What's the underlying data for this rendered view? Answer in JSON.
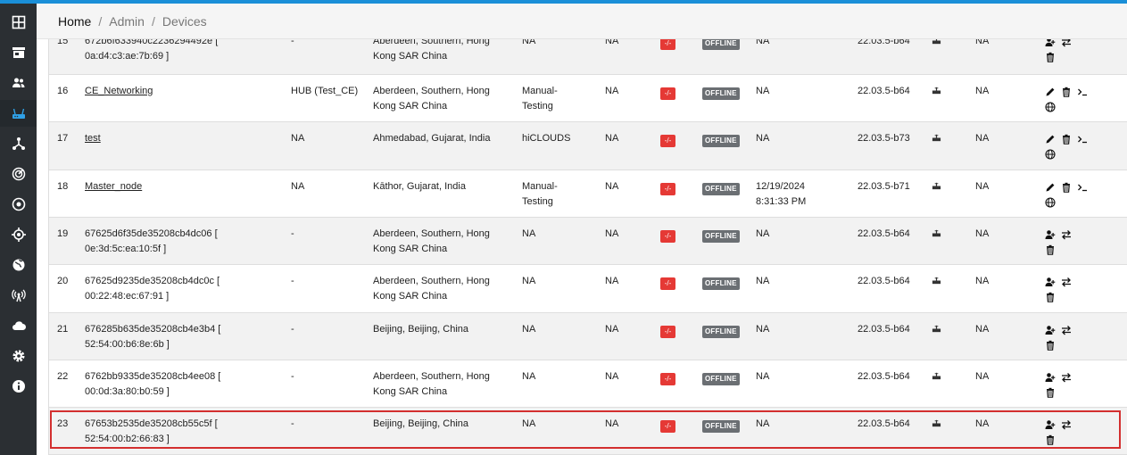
{
  "breadcrumb": {
    "home": "Home",
    "sep1": "/",
    "admin": "Admin",
    "sep2": "/",
    "devices": "Devices"
  },
  "sidebar": {
    "items": [
      {
        "icon": "dashboard-icon"
      },
      {
        "icon": "store-icon"
      },
      {
        "icon": "users-icon"
      },
      {
        "icon": "router-icon",
        "active": true
      },
      {
        "icon": "network-icon"
      },
      {
        "icon": "radar-icon"
      },
      {
        "icon": "target-icon"
      },
      {
        "icon": "crosshair-icon"
      },
      {
        "icon": "globe-icon"
      },
      {
        "icon": "antenna-icon"
      },
      {
        "icon": "cloud-icon"
      },
      {
        "icon": "settings-icon"
      },
      {
        "icon": "info-icon"
      }
    ]
  },
  "colors": {
    "accent": "#1a8fd8",
    "sidebar": "#2b2f33",
    "badge_red": "#e53935",
    "badge_offline": "#6b6f73",
    "highlight": "#d32f2f"
  },
  "rows": [
    {
      "num": "15",
      "name1": "672b6f633940c2236294492e [",
      "name2": "0a:d4:c3:ae:7b:69 ]",
      "link": false,
      "type": "-",
      "loc1": "Aberdeen, Southern, Hong",
      "loc2": "Kong SAR China",
      "org1": "NA",
      "org2": "",
      "na1": "NA",
      "badge": "-/-",
      "status": "OFFLINE",
      "time1": "NA",
      "time2": "",
      "fw": "22.03.5-b64",
      "na2": "NA",
      "actions": "A"
    },
    {
      "num": "16",
      "name1": "CE_Networking",
      "name2": "",
      "link": true,
      "type": "HUB (Test_CE)",
      "loc1": "Aberdeen, Southern, Hong",
      "loc2": "Kong SAR China",
      "org1": "Manual-",
      "org2": "Testing",
      "na1": "NA",
      "badge": "-/-",
      "status": "OFFLINE",
      "time1": "NA",
      "time2": "",
      "fw": "22.03.5-b64",
      "na2": "NA",
      "actions": "B"
    },
    {
      "num": "17",
      "name1": "test",
      "name2": "",
      "link": true,
      "type": "NA",
      "loc1": "Ahmedabad, Gujarat, India",
      "loc2": "",
      "org1": "hiCLOUDS",
      "org2": "",
      "na1": "NA",
      "badge": "-/-",
      "status": "OFFLINE",
      "time1": "NA",
      "time2": "",
      "fw": "22.03.5-b73",
      "na2": "NA",
      "actions": "B"
    },
    {
      "num": "18",
      "name1": "Master_node",
      "name2": "",
      "link": true,
      "type": "NA",
      "loc1": "Kāthor, Gujarat, India",
      "loc2": "",
      "org1": "Manual-",
      "org2": "Testing",
      "na1": "NA",
      "badge": "-/-",
      "status": "OFFLINE",
      "time1": "12/19/2024",
      "time2": "8:31:33 PM",
      "fw": "22.03.5-b71",
      "na2": "NA",
      "actions": "B"
    },
    {
      "num": "19",
      "name1": "67625d6f35de35208cb4dc06 [",
      "name2": "0e:3d:5c:ea:10:5f ]",
      "link": false,
      "type": "-",
      "loc1": "Aberdeen, Southern, Hong",
      "loc2": "Kong SAR China",
      "org1": "NA",
      "org2": "",
      "na1": "NA",
      "badge": "-/-",
      "status": "OFFLINE",
      "time1": "NA",
      "time2": "",
      "fw": "22.03.5-b64",
      "na2": "NA",
      "actions": "A"
    },
    {
      "num": "20",
      "name1": "67625d9235de35208cb4dc0c [",
      "name2": "00:22:48:ec:67:91 ]",
      "link": false,
      "type": "-",
      "loc1": "Aberdeen, Southern, Hong",
      "loc2": "Kong SAR China",
      "org1": "NA",
      "org2": "",
      "na1": "NA",
      "badge": "-/-",
      "status": "OFFLINE",
      "time1": "NA",
      "time2": "",
      "fw": "22.03.5-b64",
      "na2": "NA",
      "actions": "A"
    },
    {
      "num": "21",
      "name1": "676285b635de35208cb4e3b4 [",
      "name2": "52:54:00:b6:8e:6b ]",
      "link": false,
      "type": "-",
      "loc1": "Beijing, Beijing, China",
      "loc2": "",
      "org1": "NA",
      "org2": "",
      "na1": "NA",
      "badge": "-/-",
      "status": "OFFLINE",
      "time1": "NA",
      "time2": "",
      "fw": "22.03.5-b64",
      "na2": "NA",
      "actions": "A"
    },
    {
      "num": "22",
      "name1": "6762bb9335de35208cb4ee08 [",
      "name2": "00:0d:3a:80:b0:59 ]",
      "link": false,
      "type": "-",
      "loc1": "Aberdeen, Southern, Hong",
      "loc2": "Kong SAR China",
      "org1": "NA",
      "org2": "",
      "na1": "NA",
      "badge": "-/-",
      "status": "OFFLINE",
      "time1": "NA",
      "time2": "",
      "fw": "22.03.5-b64",
      "na2": "NA",
      "actions": "A"
    },
    {
      "num": "23",
      "name1": "67653b2535de35208cb55c5f [",
      "name2": "52:54:00:b2:66:83 ]",
      "link": false,
      "type": "-",
      "loc1": "Beijing, Beijing, China",
      "loc2": "",
      "org1": "NA",
      "org2": "",
      "na1": "NA",
      "badge": "-/-",
      "status": "OFFLINE",
      "time1": "NA",
      "time2": "",
      "fw": "22.03.5-b64",
      "na2": "NA",
      "actions": "A",
      "highlighted": true
    }
  ]
}
